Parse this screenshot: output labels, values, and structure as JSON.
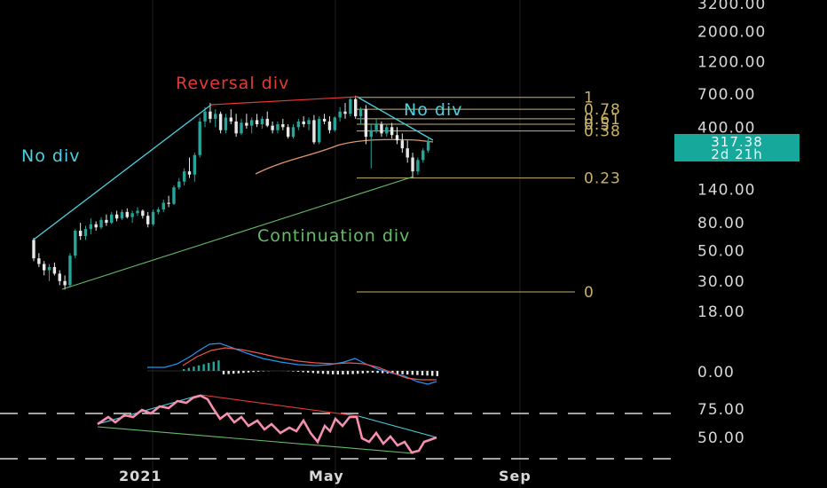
{
  "price_axis": {
    "labels": [
      {
        "text": "3200.00",
        "v": 3200
      },
      {
        "text": "2000.00",
        "v": 2000
      },
      {
        "text": "1200.00",
        "v": 1200
      },
      {
        "text": "700.00",
        "v": 700
      },
      {
        "text": "400.00",
        "v": 400
      },
      {
        "text": "140.00",
        "v": 140
      },
      {
        "text": "80.00",
        "v": 80
      },
      {
        "text": "50.00",
        "v": 50
      },
      {
        "text": "30.00",
        "v": 30
      },
      {
        "text": "18.00",
        "v": 18
      }
    ],
    "scale": "log"
  },
  "macd_axis": {
    "label": "0.00"
  },
  "rsi_axis": {
    "labels": [
      "75.00",
      "50.00"
    ]
  },
  "time_axis": {
    "labels": [
      "2021",
      "May",
      "Sep"
    ]
  },
  "current_price": {
    "value": "317.38",
    "countdown": "2d 21h",
    "color": "#16a89a"
  },
  "annotations": {
    "reversal": "Reversal div",
    "no_div_left": "No div",
    "no_div_right": "No div",
    "continuation": "Continuation div"
  },
  "fib_levels": [
    {
      "label": "1",
      "price": 660
    },
    {
      "label": "0.78",
      "price": 540
    },
    {
      "label": "0.61",
      "price": 460
    },
    {
      "label": "0.5",
      "price": 420
    },
    {
      "label": "0.38",
      "price": 375
    },
    {
      "label": "0.23",
      "price": 170
    },
    {
      "label": "0",
      "price": 25
    }
  ],
  "colors": {
    "up": "#26a69a",
    "down": "#e8e8e8",
    "reversal": "#e53935",
    "no_div": "#4dd0e1",
    "continuation": "#66bb6a",
    "fib": "#c9b26a",
    "ma": "#e0956a",
    "rsi": "#f48fb1",
    "macd_fast": "#2196f3",
    "macd_slow": "#ef5350"
  },
  "chart_data": {
    "type": "candlestick",
    "y_scale": "log",
    "x_ticks": [
      "2021",
      "May",
      "Sep"
    ],
    "ylim": [
      18,
      3200
    ],
    "series": [
      {
        "name": "",
        "values": [
          [
            60,
            62,
            42,
            44
          ],
          [
            44,
            48,
            38,
            40
          ],
          [
            40,
            42,
            33,
            36
          ],
          [
            36,
            40,
            30,
            38
          ],
          [
            38,
            41,
            33,
            34
          ],
          [
            34,
            36,
            28,
            30
          ],
          [
            30,
            33,
            26,
            28
          ],
          [
            28,
            48,
            27,
            46
          ],
          [
            46,
            72,
            44,
            70
          ],
          [
            70,
            80,
            60,
            64
          ],
          [
            64,
            76,
            60,
            72
          ],
          [
            72,
            86,
            66,
            78
          ],
          [
            78,
            82,
            70,
            74
          ],
          [
            74,
            88,
            72,
            84
          ],
          [
            84,
            92,
            76,
            80
          ],
          [
            80,
            96,
            78,
            92
          ],
          [
            92,
            98,
            82,
            86
          ],
          [
            86,
            100,
            84,
            96
          ],
          [
            96,
            102,
            86,
            88
          ],
          [
            88,
            98,
            80,
            94
          ],
          [
            94,
            104,
            90,
            98
          ],
          [
            98,
            100,
            86,
            90
          ],
          [
            90,
            96,
            74,
            78
          ],
          [
            78,
            100,
            76,
            96
          ],
          [
            96,
            104,
            92,
            100
          ],
          [
            100,
            118,
            96,
            112
          ],
          [
            112,
            126,
            104,
            110
          ],
          [
            110,
            150,
            108,
            145
          ],
          [
            145,
            170,
            140,
            160
          ],
          [
            160,
            200,
            150,
            190
          ],
          [
            190,
            240,
            170,
            180
          ],
          [
            180,
            260,
            160,
            250
          ],
          [
            250,
            470,
            240,
            440
          ],
          [
            440,
            560,
            400,
            520
          ],
          [
            520,
            600,
            430,
            460
          ],
          [
            460,
            540,
            400,
            500
          ],
          [
            500,
            520,
            360,
            380
          ],
          [
            380,
            500,
            360,
            470
          ],
          [
            470,
            540,
            420,
            440
          ],
          [
            440,
            500,
            340,
            360
          ],
          [
            360,
            460,
            350,
            430
          ],
          [
            430,
            500,
            390,
            410
          ],
          [
            410,
            470,
            360,
            450
          ],
          [
            450,
            500,
            400,
            420
          ],
          [
            420,
            480,
            390,
            460
          ],
          [
            460,
            520,
            400,
            410
          ],
          [
            410,
            440,
            360,
            380
          ],
          [
            380,
            440,
            360,
            420
          ],
          [
            420,
            460,
            380,
            400
          ],
          [
            400,
            420,
            330,
            340
          ],
          [
            340,
            420,
            330,
            400
          ],
          [
            400,
            460,
            380,
            440
          ],
          [
            440,
            480,
            400,
            420
          ],
          [
            420,
            470,
            380,
            450
          ],
          [
            450,
            490,
            300,
            310
          ],
          [
            310,
            480,
            300,
            460
          ],
          [
            460,
            500,
            420,
            440
          ],
          [
            440,
            480,
            360,
            380
          ],
          [
            380,
            480,
            370,
            470
          ],
          [
            470,
            560,
            440,
            520
          ],
          [
            520,
            600,
            460,
            500
          ],
          [
            500,
            660,
            480,
            640
          ],
          [
            640,
            680,
            460,
            480
          ],
          [
            480,
            560,
            420,
            540
          ],
          [
            540,
            580,
            300,
            340
          ],
          [
            340,
            420,
            200,
            380
          ],
          [
            380,
            460,
            360,
            420
          ],
          [
            420,
            440,
            340,
            360
          ],
          [
            360,
            420,
            340,
            400
          ],
          [
            400,
            430,
            330,
            350
          ],
          [
            350,
            400,
            300,
            320
          ],
          [
            320,
            360,
            260,
            280
          ],
          [
            280,
            320,
            220,
            240
          ],
          [
            240,
            260,
            170,
            190
          ],
          [
            190,
            240,
            180,
            230
          ],
          [
            230,
            280,
            220,
            270
          ],
          [
            270,
            330,
            260,
            317
          ]
        ]
      }
    ]
  }
}
